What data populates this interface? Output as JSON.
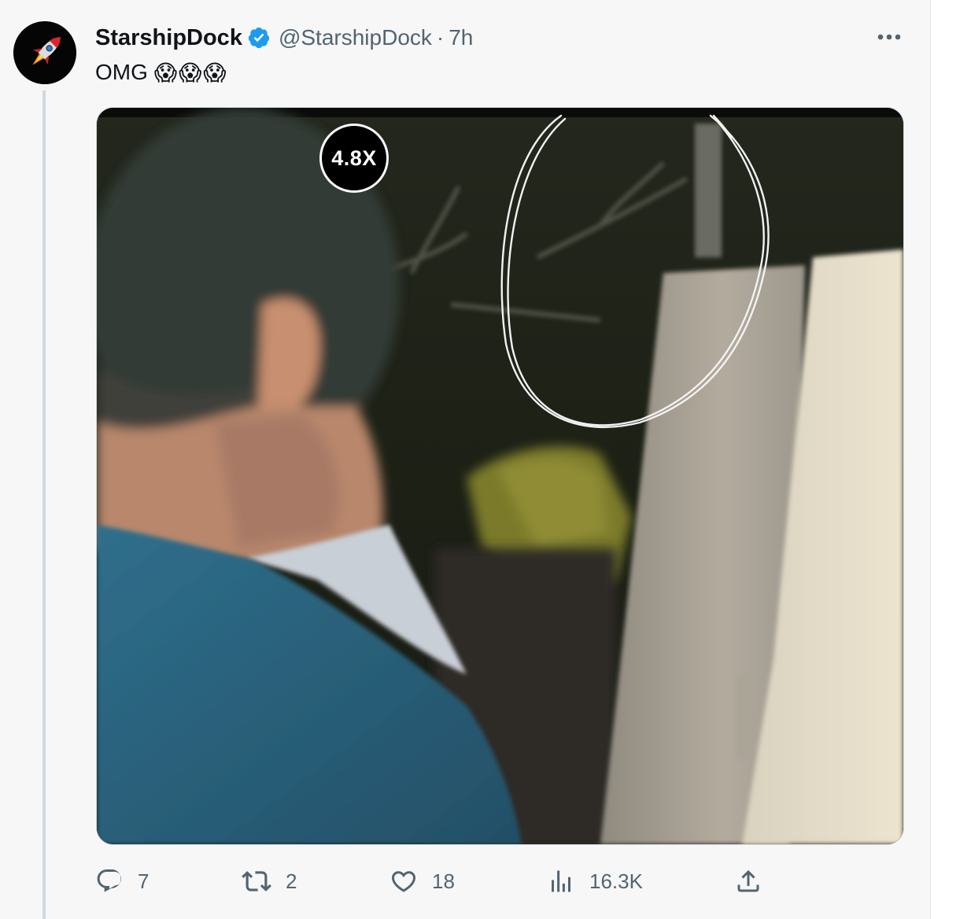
{
  "tweet": {
    "author": {
      "display_name": "StarshipDock",
      "verified_icon": "verified-badge-icon",
      "handle": "@StarshipDock",
      "separator": "·",
      "time": "7h"
    },
    "text": "OMG",
    "emojis": [
      "😱",
      "😱",
      "😱"
    ],
    "media": {
      "zoom_label": "4.8X"
    },
    "actions": {
      "replies": "7",
      "retweets": "2",
      "likes": "18",
      "views": "16.3K"
    }
  },
  "colors": {
    "verified_blue": "#1d9bf0",
    "secondary_text": "#536471",
    "primary_text": "#0f1419"
  }
}
